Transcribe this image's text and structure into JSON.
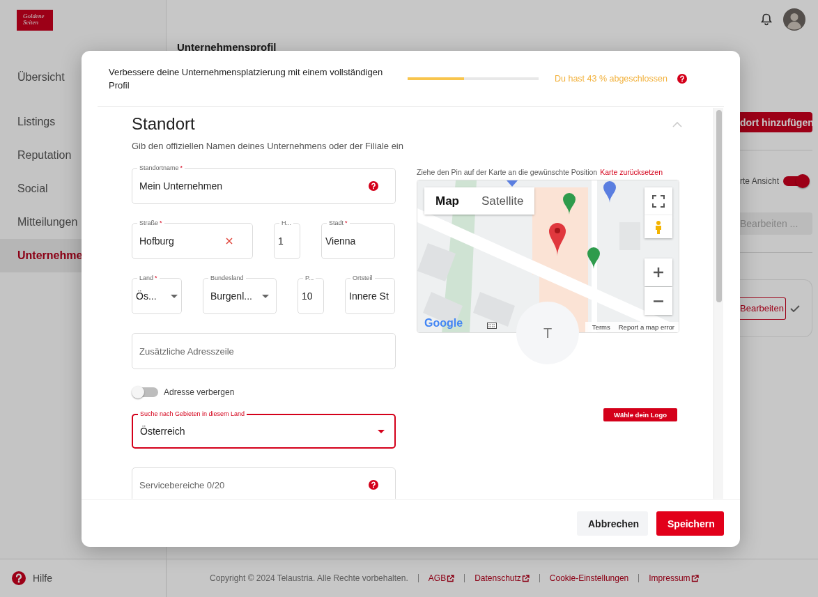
{
  "app": {
    "logo": {
      "line1": "Goldene",
      "line2": "Seiten"
    },
    "sidebar": {
      "items": [
        {
          "label": "Übersicht",
          "selected": false
        },
        {
          "label": "Listings",
          "selected": false
        },
        {
          "label": "Reputation",
          "selected": false
        },
        {
          "label": "Social",
          "selected": false
        },
        {
          "label": "Mitteilungen",
          "selected": false
        },
        {
          "label": "Unternehme",
          "selected": true
        }
      ],
      "help": "Hilfe"
    },
    "page_title": "Unternehmensprofil",
    "right_panel": {
      "add_button": "dort hinzufügen",
      "view_toggle": {
        "label": "rte Ansicht",
        "on": true
      },
      "edit_field": "Bearbeiten ...",
      "card_button": "Bearbeiten"
    },
    "footer": {
      "copyright": "Copyright © 2024 Telaustria. Alle Rechte vorbehalten.",
      "links": [
        {
          "label": "AGB",
          "external": true
        },
        {
          "label": "Datenschutz",
          "external": true
        },
        {
          "label": "Cookie-Einstellungen",
          "external": false
        },
        {
          "label": "Impressum",
          "external": true
        }
      ]
    }
  },
  "dialog": {
    "progress": {
      "text": "Verbessere deine Unternehmensplatzierung mit einem vollständigen Profil",
      "level": 0.43,
      "reading": "Du hast 43 % abgeschlossen",
      "help": true
    },
    "section": {
      "title": "Standort",
      "expanded": true,
      "subtitle": "Gib den offiziellen Namen deines Unternehmens oder der Filiale ein"
    },
    "form_rows": [
      [
        {
          "kind": "text",
          "label": "Standortname",
          "required_mark": "*",
          "value": "Mein Unternehmen",
          "help": true
        }
      ],
      [
        {
          "kind": "text",
          "label": "Straße",
          "required_mark": "*",
          "value": "Hofburg",
          "clearable": true
        },
        {
          "kind": "text",
          "label": "H...",
          "value": "1"
        },
        {
          "kind": "text",
          "label": "Stadt",
          "required_mark": "*",
          "value": "Vienna"
        }
      ],
      [
        {
          "kind": "select",
          "label": "Land",
          "required_mark": "*",
          "value": "Ös..."
        },
        {
          "kind": "select",
          "label": "Bundesland",
          "value": "Burgenl..."
        },
        {
          "kind": "text",
          "label": "P...",
          "value": "10"
        },
        {
          "kind": "text",
          "label": "Ortsteil",
          "value": "Innere St"
        }
      ],
      [
        {
          "kind": "text",
          "placeholder": "Zusätzliche Adresszeile"
        }
      ],
      [
        {
          "kind": "toggle",
          "label": "Adresse verbergen",
          "on": false
        }
      ],
      [
        {
          "kind": "select",
          "label": "Suche nach Gebieten in diesem Land",
          "value": "Österreich",
          "focused": true
        }
      ],
      [
        {
          "kind": "text",
          "placeholder": "Servicebereiche 0/20",
          "help": true
        }
      ]
    ],
    "map": {
      "instruction": "Ziehe den Pin auf der Karte an die gewünschte Position",
      "reset_link": "Karte zurücksetzen",
      "type_tabs": [
        {
          "label": "Map",
          "selected": true
        },
        {
          "label": "Satellite",
          "selected": false
        }
      ],
      "logo": "Google",
      "attribution": [
        "Terms",
        "Report a map error"
      ]
    },
    "logo_picker": {
      "initial": "T",
      "button": "Wähle dein Logo"
    },
    "buttons": [
      {
        "label": "Abbrechen",
        "kind": "secondary"
      },
      {
        "label": "Speichern",
        "kind": "primary"
      }
    ]
  }
}
